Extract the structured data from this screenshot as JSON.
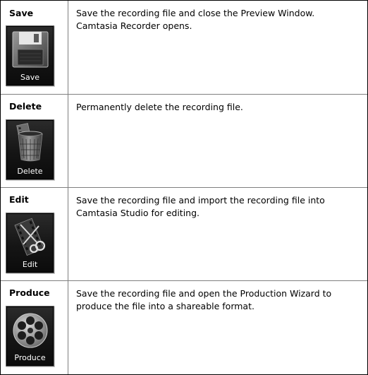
{
  "rows": [
    {
      "title": "Save",
      "button_label": "Save",
      "icon": "floppy-disk-icon",
      "desc_lines": [
        "Save the recording file and close the Preview Window.",
        "Camtasia Recorder opens."
      ]
    },
    {
      "title": "Delete",
      "button_label": "Delete",
      "icon": "trash-can-icon",
      "desc_lines": [
        "Permanently delete the recording file."
      ]
    },
    {
      "title": "Edit",
      "button_label": "Edit",
      "icon": "scissors-film-icon",
      "desc_lines": [
        "Save the recording file and import the recording file into",
        "Camtasia Studio for editing."
      ]
    },
    {
      "title": "Produce",
      "button_label": "Produce",
      "icon": "film-reel-icon",
      "desc_lines": [
        "Save the recording file and open the Production Wizard to",
        "produce the file into a shareable format."
      ]
    }
  ],
  "colors": {
    "button_bg": "#151515",
    "border": "#7f7f7f",
    "text": "#000000"
  }
}
